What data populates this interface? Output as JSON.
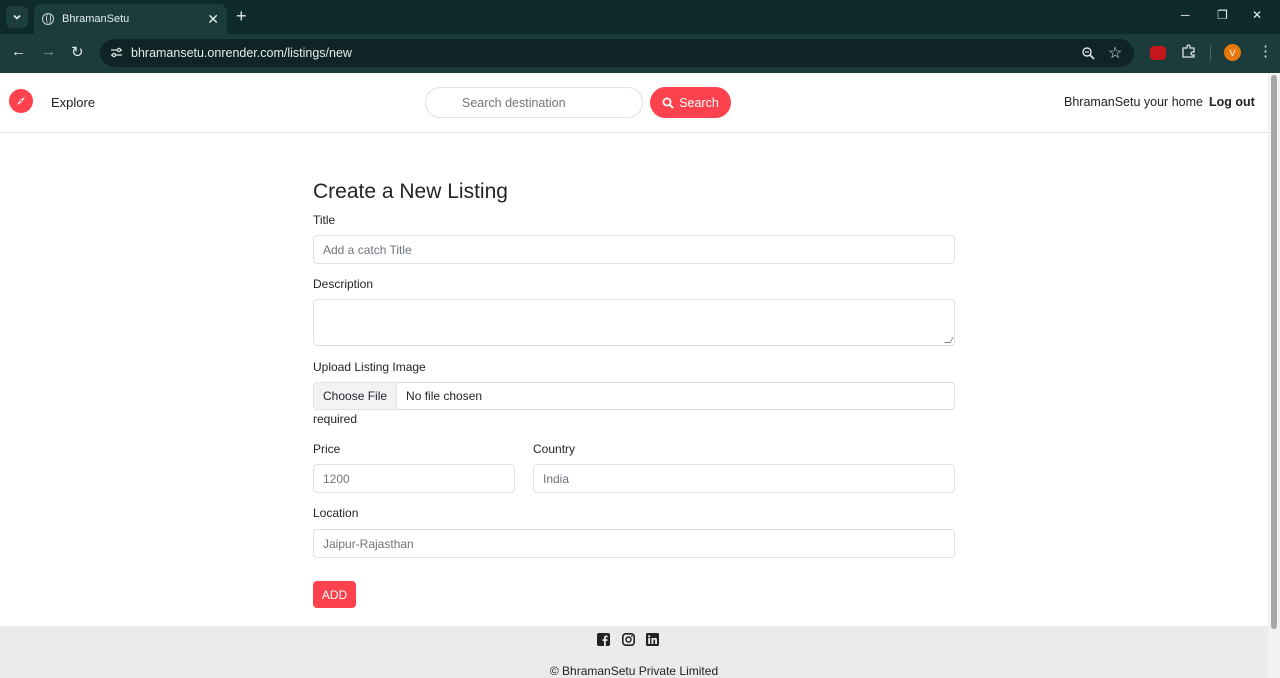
{
  "browser": {
    "tab_title": "BhramanSetu",
    "url": "bhramansetu.onrender.com/listings/new",
    "profile_initial": "V"
  },
  "navbar": {
    "explore": "Explore",
    "search_placeholder": "Search destination",
    "search_button": "Search",
    "host_link": "BhramanSetu your home",
    "logout": "Log out"
  },
  "form": {
    "heading": "Create a New Listing",
    "title_label": "Title",
    "title_placeholder": "Add a catch Title",
    "description_label": "Description",
    "image_label": "Upload Listing Image",
    "file_button": "Choose File",
    "file_status": "No file chosen",
    "image_note": "required",
    "price_label": "Price",
    "price_placeholder": "1200",
    "country_label": "Country",
    "country_placeholder": "India",
    "location_label": "Location",
    "location_placeholder": "Jaipur-Rajasthan",
    "submit": "ADD"
  },
  "footer": {
    "socials": [
      "facebook-icon",
      "instagram-icon",
      "linkedin-icon"
    ],
    "copyright": "© BhramanSetu Private Limited"
  },
  "colors": {
    "brand": "#fe424d",
    "chrome_dark": "#0f2a2a",
    "chrome_toolbar": "#1c3b3b"
  }
}
